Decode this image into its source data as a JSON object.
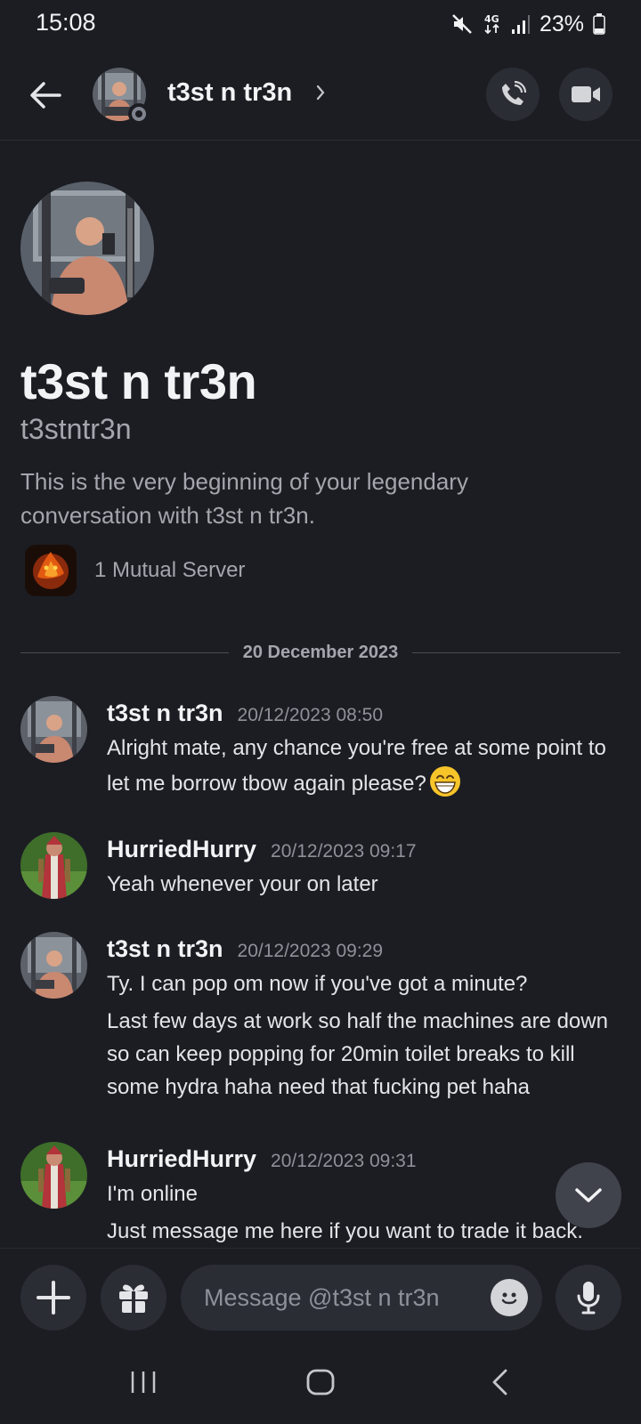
{
  "status_bar": {
    "time": "15:08",
    "network": "4G",
    "battery": "23%",
    "icons": [
      "mute-icon",
      "network-4g-icon",
      "signal-icon",
      "battery-icon"
    ]
  },
  "header": {
    "name": "t3st n tr3n",
    "icons": [
      "back-arrow-icon",
      "chevron-right-icon",
      "phone-call-icon",
      "video-camera-icon"
    ]
  },
  "intro": {
    "display_name": "t3st n tr3n",
    "username": "t3stntr3n",
    "description": "This is the very beginning of your legendary conversation with t3st n tr3n.",
    "mutual_servers": "1 Mutual Server"
  },
  "date_divider": "20 December 2023",
  "messages": [
    {
      "author": "t3st n tr3n",
      "timestamp": "20/12/2023 08:50",
      "lines": [
        "Alright mate, any chance you're free at some point to let me borrow tbow again please?"
      ],
      "emoji": "grinning-face-emoji"
    },
    {
      "author": "HurriedHurry",
      "timestamp": "20/12/2023 09:17",
      "lines": [
        "Yeah whenever your on later"
      ]
    },
    {
      "author": "t3st n tr3n",
      "timestamp": "20/12/2023 09:29",
      "lines": [
        "Ty. I can pop om now if you've got a minute?",
        "Last few days at work so half the machines are down so can keep popping for 20min toilet breaks to kill some hydra haha need that fucking pet haha"
      ]
    },
    {
      "author": "HurriedHurry",
      "timestamp": "20/12/2023 09:31",
      "lines": [
        "I'm online",
        "Just message me here if you want to trade it back."
      ]
    }
  ],
  "composer": {
    "placeholder": "Message @t3st n tr3n",
    "value": "",
    "icons": [
      "plus-icon",
      "gift-icon",
      "emoji-icon",
      "microphone-icon"
    ]
  },
  "colors": {
    "background": "#1c1d23",
    "surface": "#2b2d35",
    "text_primary": "#f2f3f5",
    "text_muted": "#a3a6ad"
  }
}
